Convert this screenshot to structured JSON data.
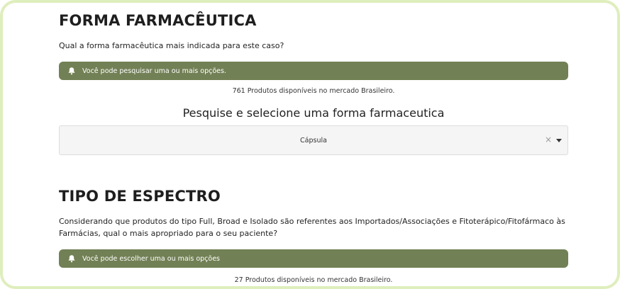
{
  "forma": {
    "title": "FORMA FARMACÊUTICA",
    "question": "Qual a forma farmacêutica mais indicada para este caso?",
    "notice": "Você pode pesquisar uma ou mais opções.",
    "count": "761 Produtos disponíveis no mercado Brasileiro.",
    "search_heading": "Pesquise e selecione uma forma farmaceutica",
    "select": {
      "value": "Cápsula",
      "clear_glyph": "×"
    }
  },
  "espectro": {
    "title": "TIPO DE ESPECTRO",
    "question": "Considerando que produtos do tipo Full, Broad e Isolado são referentes aos Importados/Associações e Fitoterápico/Fitofármaco às Farmácias, qual o mais apropriado para o seu paciente?",
    "notice": "Você pode escolher uma ou mais opções",
    "count": "27 Produtos disponíveis no mercado Brasileiro."
  },
  "colors": {
    "accent": "#728055",
    "frame": "#dfeebd"
  }
}
